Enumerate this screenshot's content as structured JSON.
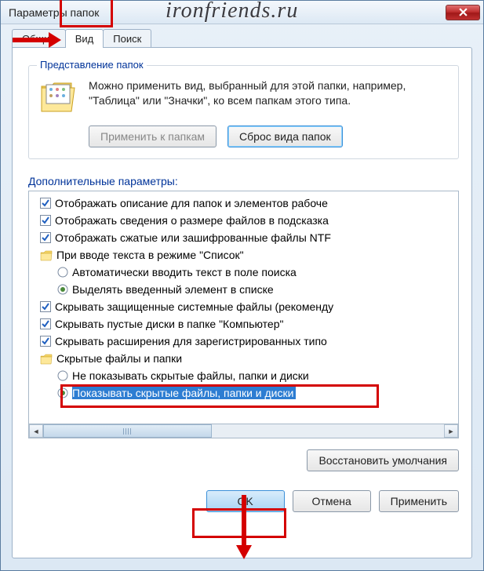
{
  "window": {
    "title": "Параметры папок"
  },
  "watermark": "ironfriends.ru",
  "tabs": {
    "general": "Общие",
    "view": "Вид",
    "search": "Поиск"
  },
  "group": {
    "title": "Представление папок",
    "text": "Можно применить вид, выбранный для этой папки, например, \"Таблица\" или \"Значки\", ко всем папкам этого типа.",
    "apply_btn": "Применить к папкам",
    "reset_btn": "Сброс вида папок"
  },
  "advanced": {
    "label": "Дополнительные параметры:",
    "items": [
      {
        "type": "check",
        "checked": true,
        "indent": 1,
        "text": "Отображать описание для папок и элементов рабоче"
      },
      {
        "type": "check",
        "checked": true,
        "indent": 1,
        "text": "Отображать сведения о размере файлов в подсказка"
      },
      {
        "type": "check",
        "checked": true,
        "indent": 1,
        "text": "Отображать сжатые или зашифрованные файлы NTF"
      },
      {
        "type": "folder",
        "indent": 1,
        "text": "При вводе текста в режиме \"Список\""
      },
      {
        "type": "radio",
        "checked": false,
        "indent": 2,
        "text": "Автоматически вводить текст в поле поиска"
      },
      {
        "type": "radio",
        "checked": true,
        "indent": 2,
        "text": "Выделять введенный элемент в списке"
      },
      {
        "type": "check",
        "checked": true,
        "indent": 1,
        "text": "Скрывать защищенные системные файлы (рекоменду"
      },
      {
        "type": "check",
        "checked": true,
        "indent": 1,
        "text": "Скрывать пустые диски в папке \"Компьютер\""
      },
      {
        "type": "check",
        "checked": true,
        "indent": 1,
        "text": "Скрывать расширения для зарегистрированных типо"
      },
      {
        "type": "folder",
        "indent": 1,
        "text": "Скрытые файлы и папки"
      },
      {
        "type": "radio",
        "checked": false,
        "indent": 2,
        "text": "Не показывать скрытые файлы, папки и диски"
      },
      {
        "type": "radio",
        "checked": true,
        "indent": 2,
        "selected": true,
        "text": "Показывать скрытые файлы, папки и диски"
      }
    ],
    "restore_btn": "Восстановить умолчания"
  },
  "buttons": {
    "ok": "OK",
    "cancel": "Отмена",
    "apply": "Применить"
  }
}
